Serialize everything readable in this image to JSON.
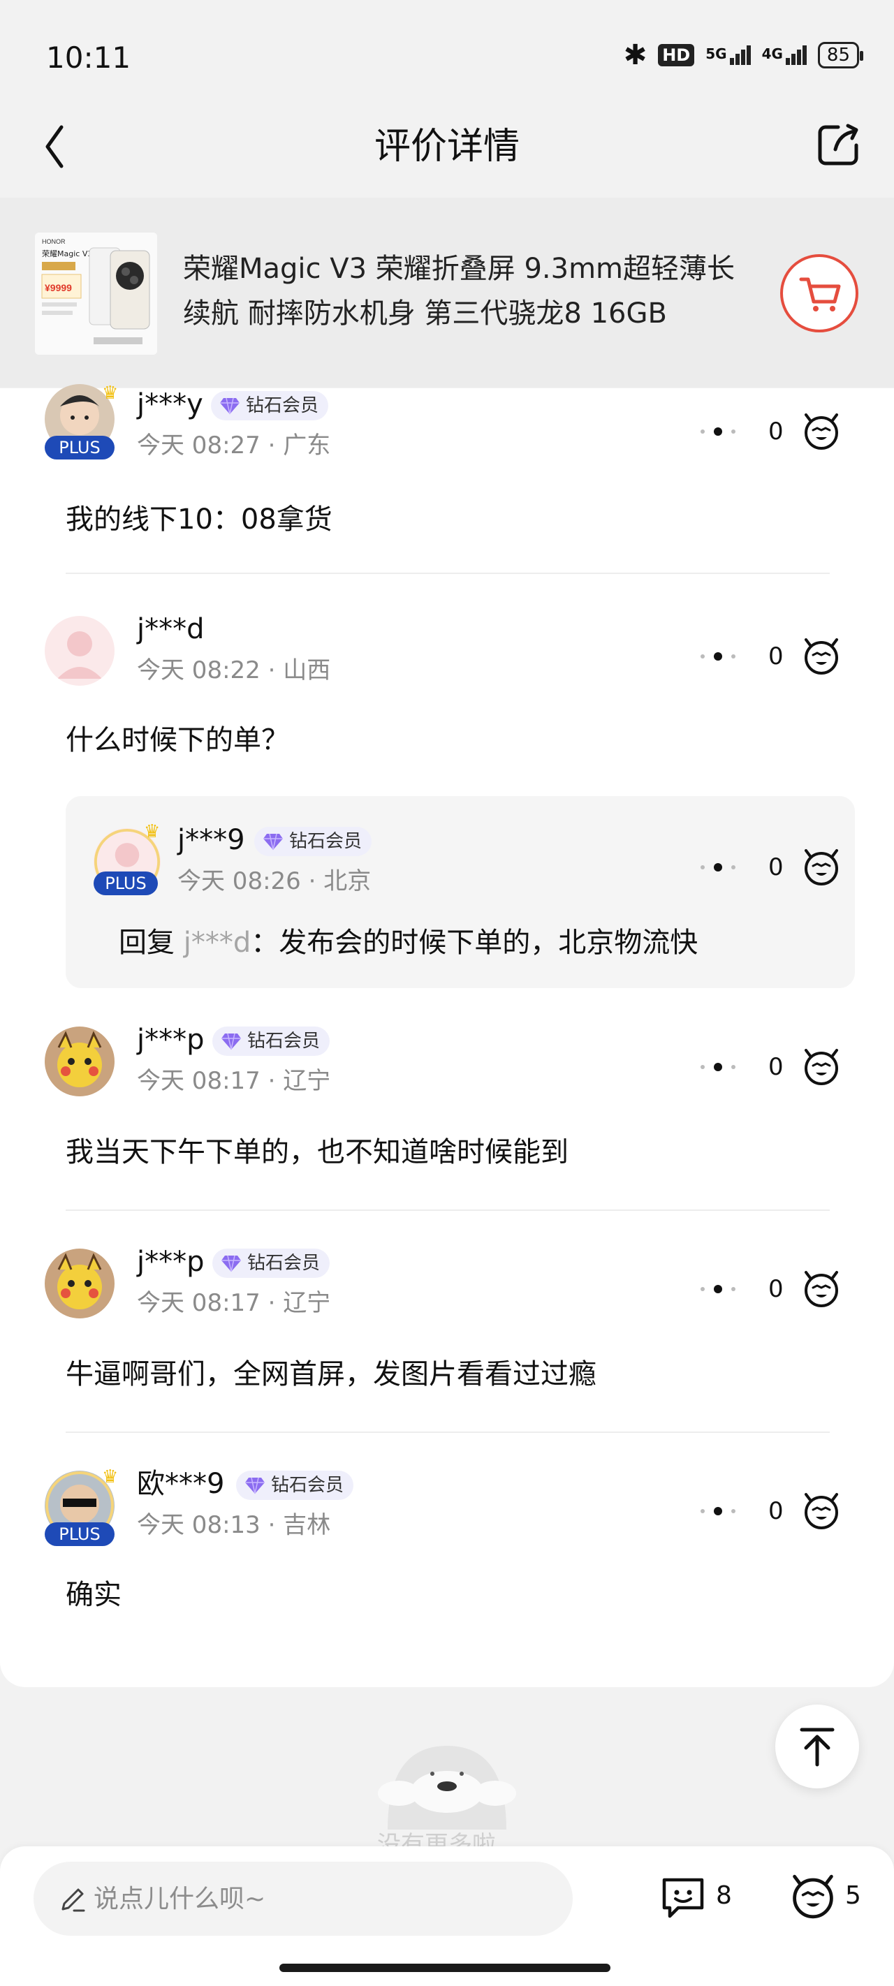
{
  "status_bar": {
    "time": "10:11",
    "hd": "HD",
    "net1": "5G",
    "net2": "4G",
    "battery": "85"
  },
  "nav": {
    "title": "评价详情"
  },
  "product": {
    "title": "荣耀Magic V3 荣耀折叠屏 9.3mm超轻薄长续航 耐摔防水机身 第三代骁龙8 16GB",
    "thumb_brand": "HONOR",
    "thumb_name": "荣耀Magic V3",
    "thumb_price": "¥9999"
  },
  "comments": [
    {
      "user": "j***y",
      "vip": "钻石会员",
      "plus": "PLUS",
      "time": "今天 08:27",
      "region": "广东",
      "text": "我的线下10：08拿货",
      "likes": "0"
    },
    {
      "user": "j***d",
      "time": "今天 08:22",
      "region": "山西",
      "text": "什么时候下的单？",
      "likes": "0",
      "reply": {
        "user": "j***9",
        "vip": "钻石会员",
        "plus": "PLUS",
        "time": "今天 08:26",
        "region": "北京",
        "prefix": "回复 ",
        "mention": "j***d",
        "text": "：发布会的时候下单的，北京物流快",
        "likes": "0"
      }
    },
    {
      "user": "j***p",
      "vip": "钻石会员",
      "time": "今天 08:17",
      "region": "辽宁",
      "text": "我当天下午下单的，也不知道啥时候能到",
      "likes": "0"
    },
    {
      "user": "j***p",
      "vip": "钻石会员",
      "time": "今天 08:17",
      "region": "辽宁",
      "text": "牛逼啊哥们，全网首屏，发图片看看过过瘾",
      "likes": "0"
    },
    {
      "user": "欧***9",
      "vip": "钻石会员",
      "plus": "PLUS",
      "time": "今天 08:13",
      "region": "吉林",
      "text": "确实",
      "likes": "0"
    }
  ],
  "meta_separator": " · ",
  "empty_state": {
    "text": "没有更多啦"
  },
  "bottom_bar": {
    "input_placeholder": "说点儿什么呗~",
    "comment_count": "8",
    "like_count": "5"
  },
  "colors": {
    "accent_red": "#e54d3e",
    "plus_blue": "#1e4ab7",
    "vip_bg": "#efeffb",
    "gem_purple": "#8b6cf0"
  },
  "icons": [
    "back-arrow-icon",
    "share-icon",
    "cart-icon",
    "more-dots-icon",
    "like-face-icon",
    "diamond-icon",
    "pen-icon",
    "comment-icon",
    "back-to-top-icon"
  ]
}
